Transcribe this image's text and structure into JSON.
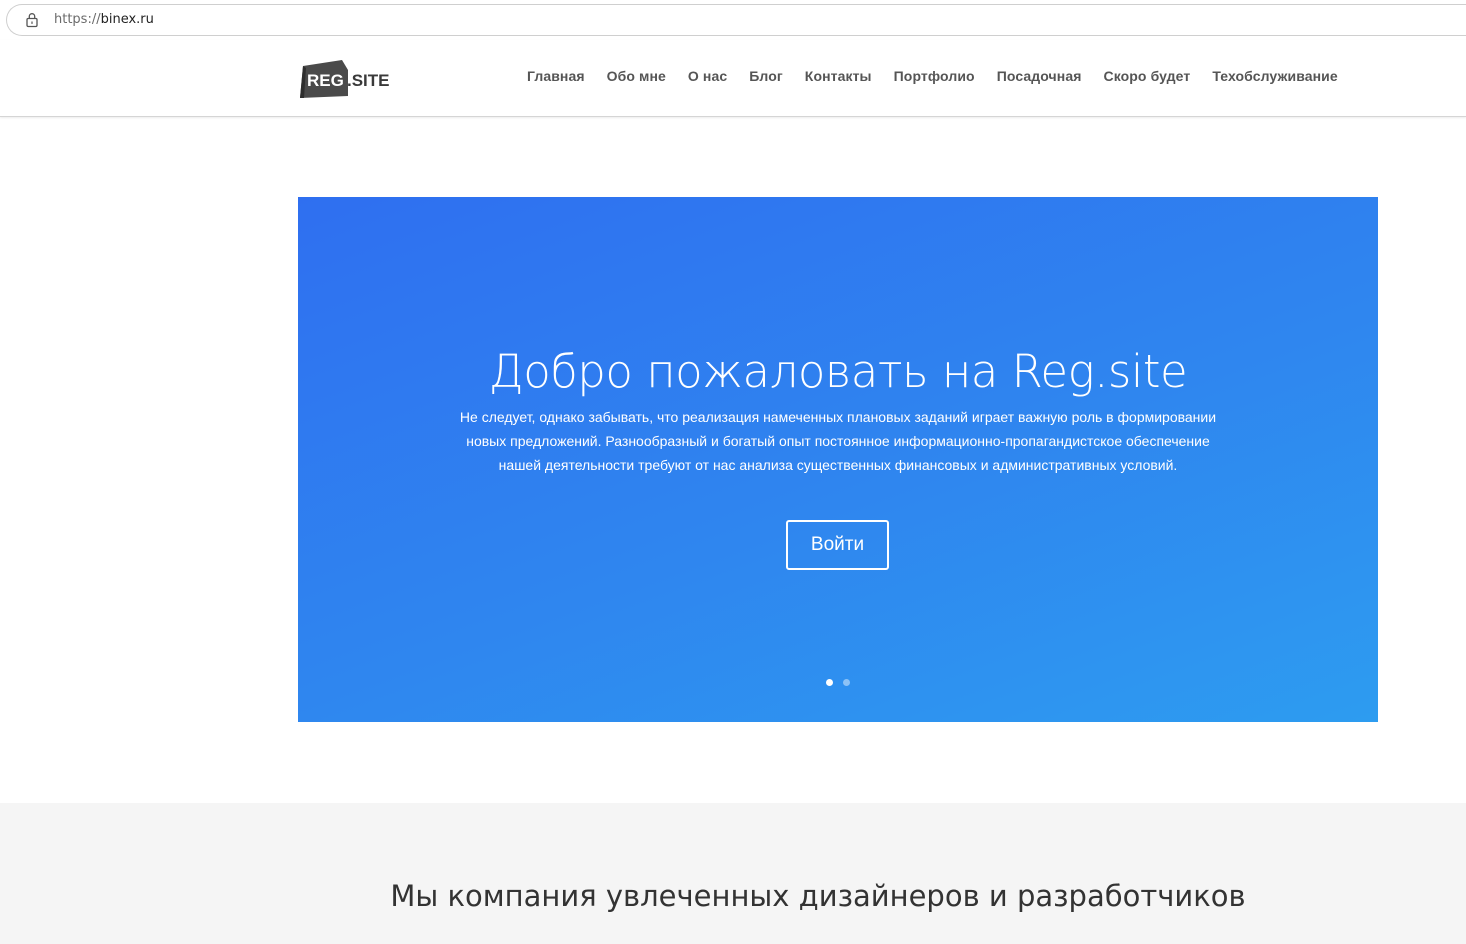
{
  "browser": {
    "url_scheme": "https://",
    "url_host": "binex.ru"
  },
  "header": {
    "logo": {
      "reg": "REG",
      "site": ".SITE"
    },
    "nav": [
      {
        "label": "Главная"
      },
      {
        "label": "Обо мне"
      },
      {
        "label": "О нас"
      },
      {
        "label": "Блог"
      },
      {
        "label": "Контакты"
      },
      {
        "label": "Портфолио"
      },
      {
        "label": "Посадочная"
      },
      {
        "label": "Скоро будет"
      },
      {
        "label": "Техобслуживание"
      }
    ]
  },
  "hero": {
    "title": "Добро пожаловать на Reg.site",
    "text": "Не следует, однако забывать, что реализация намеченных плановых заданий играет важную роль в формировании новых предложений. Разнообразный и богатый опыт постоянное информационно-пропагандистское обеспечение нашей деятельности требуют от нас анализа существенных финансовых и административных условий.",
    "button_label": "Войти",
    "slides_total": 2,
    "active_slide": 1,
    "colors": {
      "gradient_start": "#2f6ff0",
      "gradient_end": "#2d9cf0"
    }
  },
  "section": {
    "title": "Мы компания увлеченных дизайнеров и разработчиков"
  }
}
